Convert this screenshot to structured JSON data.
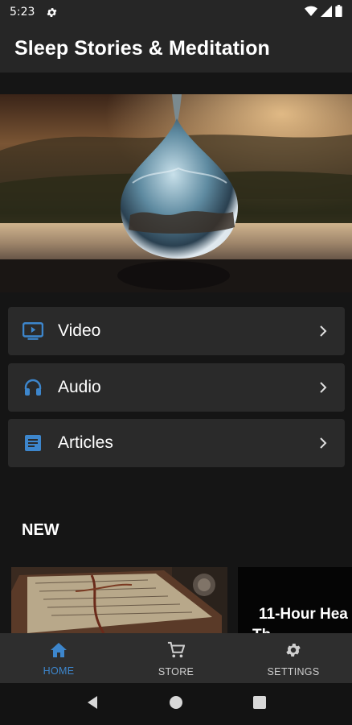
{
  "status_bar": {
    "time": "5:23",
    "icons": [
      "settings-gear-icon",
      "wifi-icon",
      "signal-icon",
      "battery-icon"
    ]
  },
  "app_bar": {
    "title": "Sleep Stories & Meditation"
  },
  "hero": {
    "image": "water-droplet-landscape"
  },
  "menu": [
    {
      "label": "Video",
      "icon": "video-tv-icon"
    },
    {
      "label": "Audio",
      "icon": "headphones-icon"
    },
    {
      "label": "Articles",
      "icon": "article-icon"
    }
  ],
  "new_section": {
    "title": "NEW",
    "tiles": [
      {
        "image": "old-book-with-bookmark"
      },
      {
        "title": "11-Hour Hea",
        "subtitle": "Th"
      }
    ]
  },
  "bottom_nav": [
    {
      "label": "HOME",
      "icon": "home-icon",
      "active": true
    },
    {
      "label": "STORE",
      "icon": "cart-icon",
      "active": false
    },
    {
      "label": "SETTINGS",
      "icon": "gear-icon",
      "active": false
    }
  ],
  "colors": {
    "accent": "#3d86cc",
    "background": "#151515",
    "card": "#2a2a2a",
    "bar": "#262626"
  }
}
